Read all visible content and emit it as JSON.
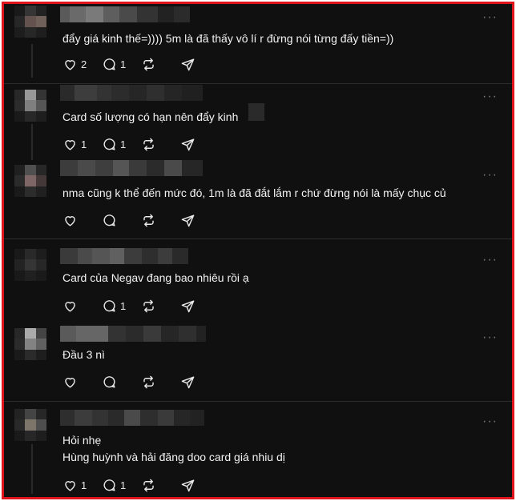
{
  "colors": {
    "background": "#101010",
    "text": "#f3f3f3",
    "border": "#e0141c",
    "icon": "#e8e8e8"
  },
  "icons": {
    "like": "heart-icon",
    "reply": "comment-bubble-icon",
    "repost": "repost-icon",
    "share": "send-icon",
    "more": "more-icon"
  },
  "more_label": "···",
  "comments": [
    {
      "lines": [
        "đẩy giá kinh thế=)))) 5m là đã thấy vô lí r đừng nói từng đấy tiền=))"
      ],
      "likes": "2",
      "replies": "1",
      "reposts": "",
      "shares": ""
    },
    {
      "lines": [
        "Card số lượng có hạn nên đẩy kinh"
      ],
      "likes": "1",
      "replies": "1",
      "reposts": "",
      "shares": ""
    },
    {
      "lines": [
        "nma cũng k thể đến mức đó, 1m là đã đắt lắm r chứ đừng nói là mấy chục củ"
      ],
      "likes": "",
      "replies": "",
      "reposts": "",
      "shares": ""
    },
    {
      "lines": [
        "Card của Negav đang bao nhiêu rồi ạ"
      ],
      "likes": "",
      "replies": "1",
      "reposts": "",
      "shares": ""
    },
    {
      "lines": [
        "Đầu 3 nì"
      ],
      "likes": "",
      "replies": "",
      "reposts": "",
      "shares": ""
    },
    {
      "lines": [
        "Hỏi nhẹ",
        "Hùng huỳnh và hải đăng doo card giá nhiu dị"
      ],
      "likes": "1",
      "replies": "1",
      "reposts": "",
      "shares": ""
    }
  ]
}
